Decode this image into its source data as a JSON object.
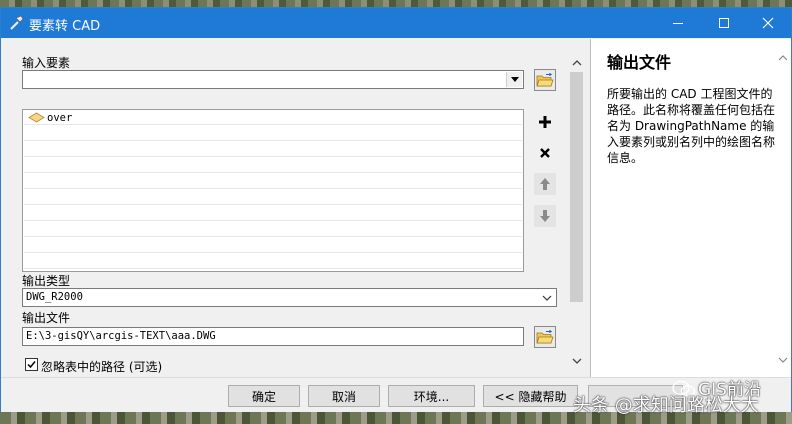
{
  "window": {
    "title": "要素转 CAD"
  },
  "form": {
    "input_features_label": "输入要素",
    "input_features_value": "",
    "feature_list": [
      {
        "name": "over",
        "icon": "polygon-layer-icon"
      }
    ],
    "output_type_label": "输出类型",
    "output_type_value": "DWG_R2000",
    "output_file_label": "输出文件",
    "output_file_value": "E:\\3-gisQY\\arcgis-TEXT\\aaa.DWG",
    "ignore_paths_label": "忽略表中的路径 (可选)",
    "ignore_paths_checked": true
  },
  "help": {
    "title": "输出文件",
    "body": "所要输出的 CAD 工程图文件的路径。此名称将覆盖任何包括在名为 DrawingPathName 的输入要素列或别名列中的绘图名称信息。"
  },
  "buttons": {
    "ok": "确定",
    "cancel": "取消",
    "environments": "环境...",
    "hide_help": "<< 隐藏帮助"
  },
  "watermark": {
    "line1": "GIS前沿",
    "line2": "头条 @求知问路松大大"
  },
  "colors": {
    "titlebar": "#1f7ad6",
    "window_bg": "#f0f0f0",
    "help_bg": "#ffffff"
  }
}
